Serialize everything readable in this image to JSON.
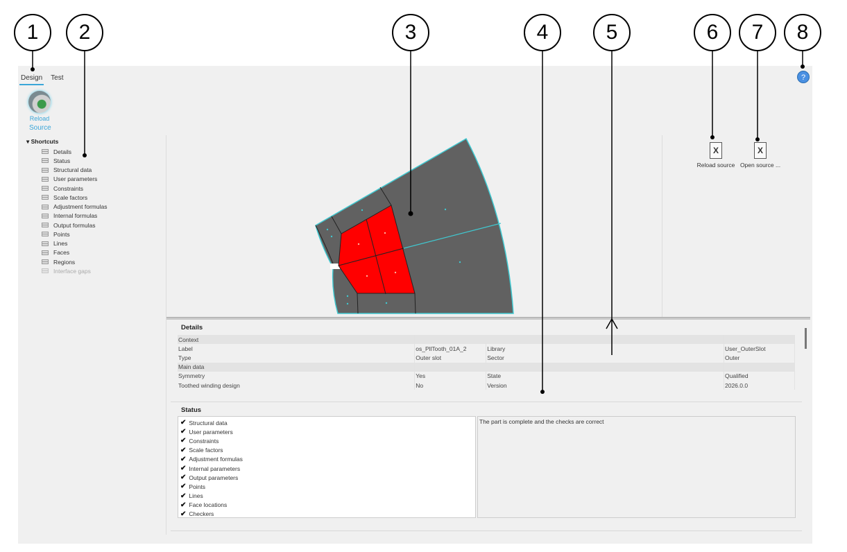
{
  "tabs": [
    {
      "label": "Design"
    },
    {
      "label": "Test"
    }
  ],
  "ribbon": {
    "reload_label": "Reload",
    "group_label": "Source"
  },
  "shortcuts": {
    "title": "Shortcuts",
    "items": [
      {
        "label": "Details"
      },
      {
        "label": "Status"
      },
      {
        "label": "Structural data"
      },
      {
        "label": "User parameters"
      },
      {
        "label": "Constraints"
      },
      {
        "label": "Scale factors"
      },
      {
        "label": "Adjustment formulas"
      },
      {
        "label": "Internal formulas"
      },
      {
        "label": "Output formulas"
      },
      {
        "label": "Points"
      },
      {
        "label": "Lines"
      },
      {
        "label": "Faces"
      },
      {
        "label": "Regions"
      },
      {
        "label": "Interface gaps",
        "disabled": true
      }
    ]
  },
  "actions": {
    "reload_source": "Reload source",
    "open_source": "Open source ...",
    "help": "?"
  },
  "details": {
    "title": "Details",
    "rows": [
      [
        "Context",
        "",
        "",
        ""
      ],
      [
        "Label",
        "os_PllTooth_01A_2",
        "Library",
        "User_OuterSlot"
      ],
      [
        "Type",
        "Outer slot",
        "Sector",
        "Outer"
      ],
      [
        "Main data",
        "",
        "",
        ""
      ],
      [
        "Symmetry",
        "Yes",
        "State",
        "Qualified"
      ],
      [
        "Toothed winding design",
        "No",
        "Version",
        "2026.0.0"
      ]
    ]
  },
  "status": {
    "title": "Status",
    "items": [
      "Structural data",
      "User parameters",
      "Constraints",
      "Scale factors",
      "Adjustment formulas",
      "Internal parameters",
      "Output parameters",
      "Points",
      "Lines",
      "Face locations",
      "Checkers"
    ],
    "message": "The part is complete and the checks are correct"
  },
  "callouts": [
    "1",
    "2",
    "3",
    "4",
    "5",
    "6",
    "7",
    "8"
  ],
  "colors": {
    "accent": "#3aa6d8",
    "face": "#616161",
    "region": "#ff0000",
    "edge": "#40c8d0"
  }
}
